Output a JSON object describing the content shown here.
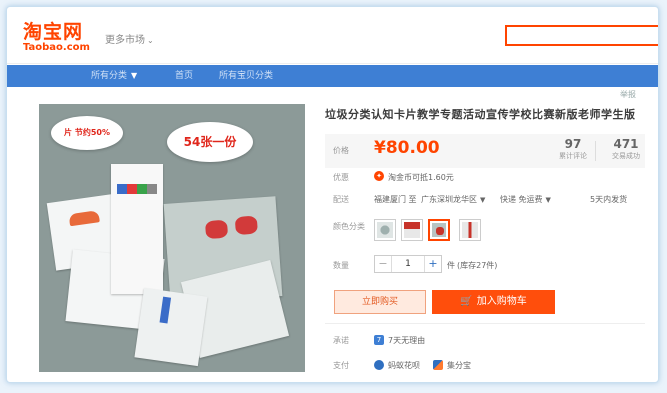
{
  "header": {
    "logo_cn": "淘宝网",
    "logo_en": "Taobao.com",
    "market_dropdown": "更多市场",
    "top_right_link": "举报"
  },
  "nav": {
    "items": [
      "所有分类",
      "首页",
      "所有宝贝分类"
    ]
  },
  "product": {
    "title": "垃圾分类认知卡片教学专题活动宣传学校比赛新版老师学生版",
    "image_bubble_large": "54张一份",
    "image_bubble_small": "片 节约50%",
    "price_label": "价格",
    "price": "¥80.00",
    "stats": [
      {
        "num": "97",
        "label": "累计评论"
      },
      {
        "num": "471",
        "label": "交易成功"
      }
    ],
    "promo_label": "优惠",
    "promo_text": "淘金币可抵1.60元",
    "shipping_label": "配送",
    "shipping_from": "福建厦门 至",
    "shipping_to": "广东深圳龙华区",
    "shipping_method": "快递 免运费",
    "shipping_time": "5天内发货",
    "sku_label": "颜色分类",
    "qty_label": "数量",
    "qty_value": "1",
    "qty_unit": "件",
    "stock": "(库存27件)",
    "buy_now": "立即购买",
    "add_cart": "加入购物车",
    "promise_label": "承诺",
    "promise_text": "7天无理由",
    "payment_label": "支付",
    "payment_items": [
      "蚂蚁花呗",
      "集分宝"
    ]
  },
  "colors": {
    "brand": "#ff4400",
    "nav": "#3e7fd4"
  }
}
